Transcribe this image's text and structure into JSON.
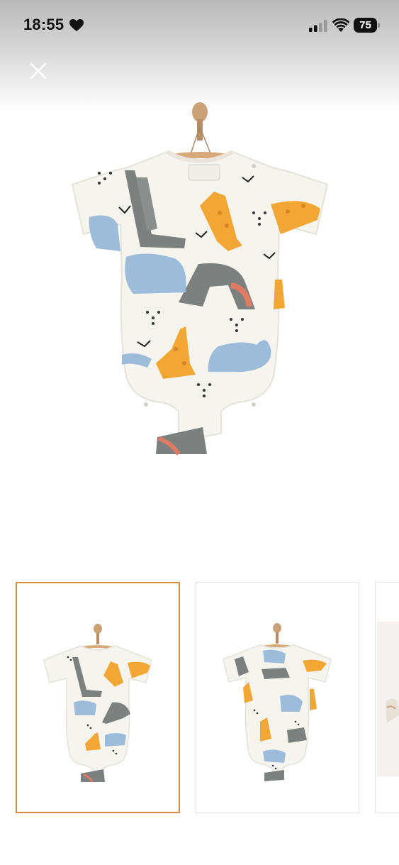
{
  "status_bar": {
    "time": "18:55",
    "battery_level": "75",
    "icons": [
      "heart-icon",
      "cellular-signal-icon",
      "wifi-icon",
      "battery-icon"
    ]
  },
  "viewer": {
    "close_icon": "close-icon",
    "selected_thumbnail_index": 0,
    "thumbnail_count_visible": 3,
    "colors": {
      "selected_border": "#d88a3f",
      "thumbnail_border": "#e3e3e3",
      "garment_base": "#f6f4ef",
      "giraffe": "#f2a735",
      "elephant": "#9dbcd9",
      "crocodile": "#7c807e",
      "hanger_wood": "#d7aa7c"
    }
  }
}
